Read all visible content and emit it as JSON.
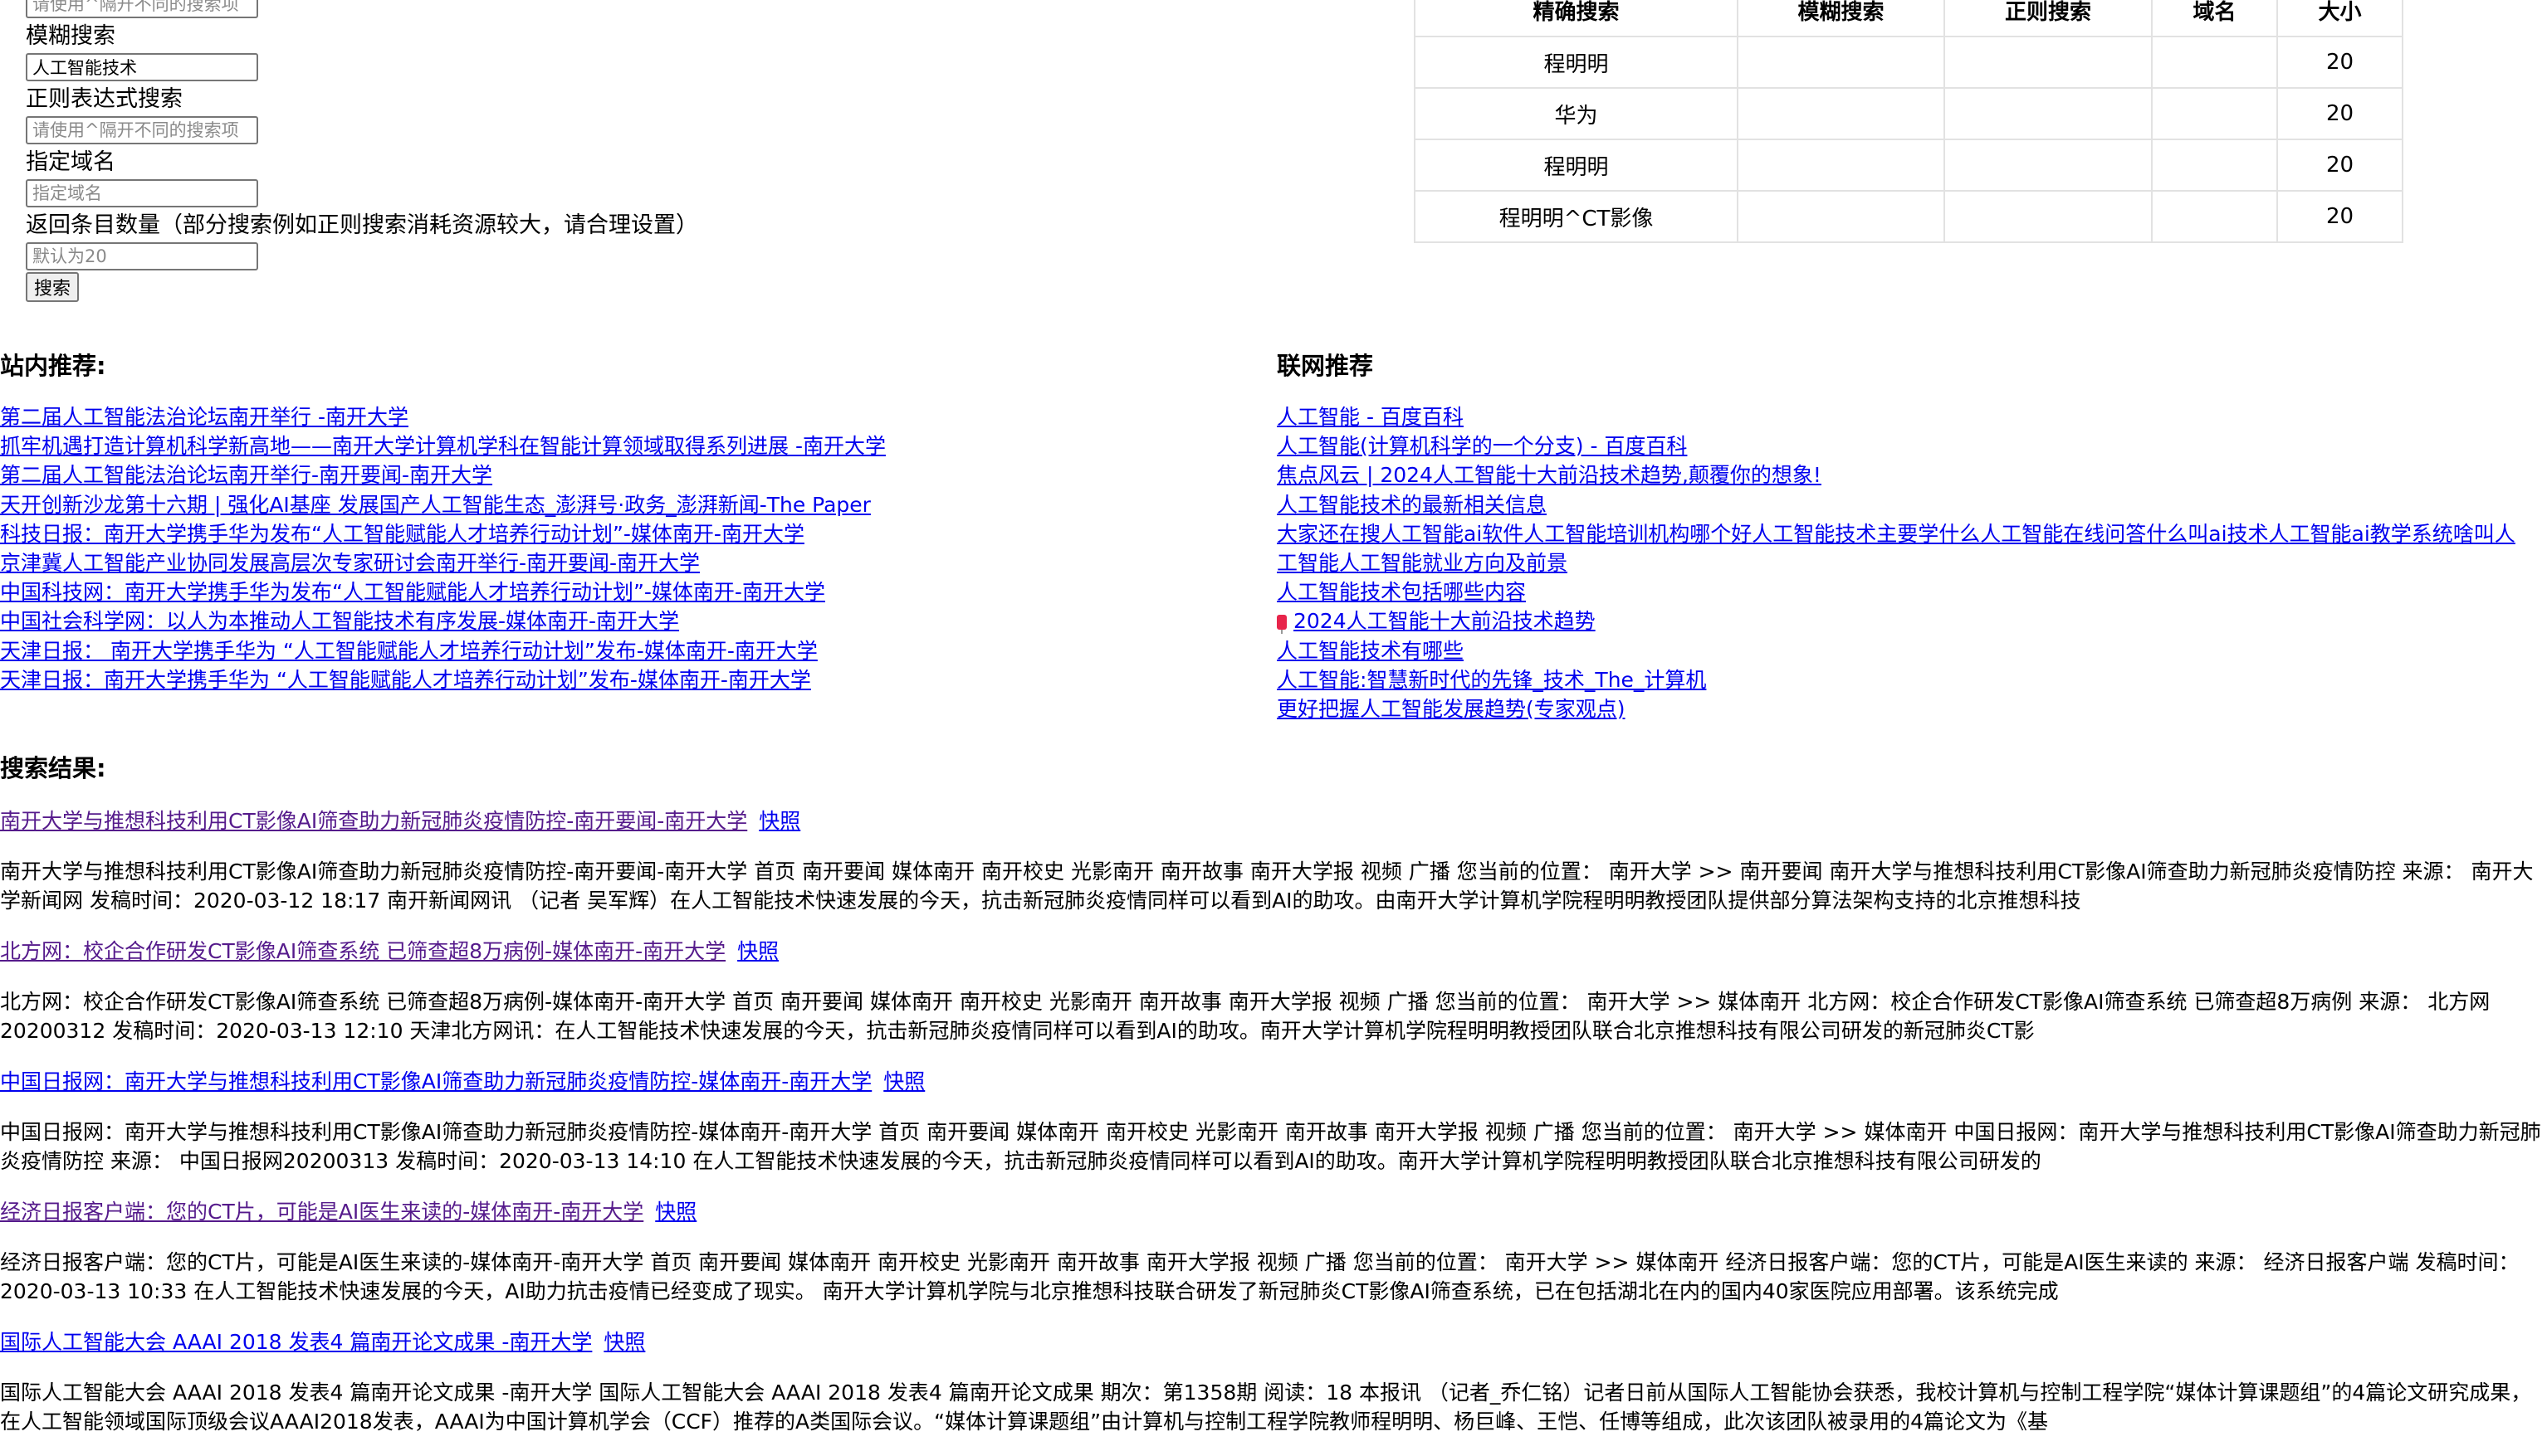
{
  "form": {
    "exact_placeholder": "请使用^隔开不同的搜索项",
    "fuzzy_label": "模糊搜索",
    "fuzzy_value": "人工智能技术",
    "regex_label": "正则表达式搜索",
    "regex_placeholder": "请使用^隔开不同的搜索项",
    "domain_label": "指定域名",
    "domain_placeholder": "指定域名",
    "count_label": "返回条目数量（部分搜索例如正则搜索消耗资源较大，请合理设置）",
    "count_placeholder": "默认为20",
    "search_button": "搜索"
  },
  "history_table": {
    "headers": [
      "精确搜索",
      "模糊搜索",
      "正则搜索",
      "域名",
      "大小"
    ],
    "rows": [
      [
        "程明明",
        "",
        "",
        "",
        "20"
      ],
      [
        "华为",
        "",
        "",
        "",
        "20"
      ],
      [
        "程明明",
        "",
        "",
        "",
        "20"
      ],
      [
        "程明明^CT影像",
        "",
        "",
        "",
        "20"
      ]
    ]
  },
  "site_recommend": {
    "heading": "站内推荐:",
    "links": [
      "第二届人工智能法治论坛南开举行 -南开大学",
      "抓牢机遇打造计算机科学新高地——南开大学计算机学科在智能计算领域取得系列进展 -南开大学",
      "第二届人工智能法治论坛南开举行-南开要闻-南开大学",
      "天开创新沙龙第十六期 | 强化AI基座 发展国产人工智能生态_澎湃号·政务_澎湃新闻-The Paper",
      "科技日报：南开大学携手华为发布“人工智能赋能人才培养行动计划”-媒体南开-南开大学",
      "京津冀人工智能产业协同发展高层次专家研讨会南开举行-南开要闻-南开大学",
      "中国科技网：南开大学携手华为发布“人工智能赋能人才培养行动计划”-媒体南开-南开大学",
      "中国社会科学网：以人为本推动人工智能技术有序发展-媒体南开-南开大学",
      "天津日报： 南开大学携手华为 “人工智能赋能人才培养行动计划”发布-媒体南开-南开大学",
      "天津日报：南开大学携手华为 “人工智能赋能人才培养行动计划”发布-媒体南开-南开大学"
    ]
  },
  "web_recommend": {
    "heading": "联网推荐",
    "links": [
      "人工智能 - 百度百科",
      "人工智能(计算机科学的一个分支) - 百度百科",
      "焦点风云 | 2024人工智能十大前沿技术趋势,颠覆你的想象!",
      "人工智能技术的最新相关信息",
      "大家还在搜人工智能ai软件人工智能培训机构哪个好人工智能技术主要学什么人工智能在线问答什么叫ai技术人工智能ai教学系统啥叫人",
      "工智能人工智能就业方向及前景",
      "人工智能技术包括哪些内容",
      "2024人工智能十大前沿技术趋势",
      "人工智能技术有哪些",
      "人工智能:智慧新时代的先锋_技术_The_计算机",
      "更好把握人工智能发展趋势(专家观点)"
    ]
  },
  "results": {
    "heading": "搜索结果:",
    "snapshot_label": "快照",
    "items": [
      {
        "title": "南开大学与推想科技利用CT影像AI筛查助力新冠肺炎疫情防控-南开要闻-南开大学",
        "snippet": "南开大学与推想科技利用CT影像AI筛查助力新冠肺炎疫情防控-南开要闻-南开大学 首页 南开要闻 媒体南开 南开校史 光影南开 南开故事 南开大学报 视频 广播 您当前的位置： 南开大学 >> 南开要闻 南开大学与推想科技利用CT影像AI筛查助力新冠肺炎疫情防控 来源： 南开大学新闻网 发稿时间：2020-03-12 18:17 南开新闻网讯 （记者 吴军辉）在人工智能技术快速发展的今天，抗击新冠肺炎疫情同样可以看到AI的助攻。由南开大学计算机学院程明明教授团队提供部分算法架构支持的北京推想科技"
      },
      {
        "title": "北方网：校企合作研发CT影像AI筛查系统 已筛查超8万病例-媒体南开-南开大学",
        "snippet": "北方网：校企合作研发CT影像AI筛查系统 已筛查超8万病例-媒体南开-南开大学 首页 南开要闻 媒体南开 南开校史 光影南开 南开故事 南开大学报 视频 广播 您当前的位置： 南开大学 >> 媒体南开 北方网：校企合作研发CT影像AI筛查系统 已筛查超8万病例 来源： 北方网20200312 发稿时间：2020-03-13 12:10 天津北方网讯：在人工智能技术快速发展的今天，抗击新冠肺炎疫情同样可以看到AI的助攻。南开大学计算机学院程明明教授团队联合北京推想科技有限公司研发的新冠肺炎CT影"
      },
      {
        "title": "中国日报网：南开大学与推想科技利用CT影像AI筛查助力新冠肺炎疫情防控-媒体南开-南开大学",
        "snippet": "中国日报网：南开大学与推想科技利用CT影像AI筛查助力新冠肺炎疫情防控-媒体南开-南开大学 首页 南开要闻 媒体南开 南开校史 光影南开 南开故事 南开大学报 视频 广播 您当前的位置： 南开大学 >> 媒体南开 中国日报网：南开大学与推想科技利用CT影像AI筛查助力新冠肺炎疫情防控 来源： 中国日报网20200313 发稿时间：2020-03-13 14:10 在人工智能技术快速发展的今天，抗击新冠肺炎疫情同样可以看到AI的助攻。南开大学计算机学院程明明教授团队联合北京推想科技有限公司研发的"
      },
      {
        "title": "经济日报客户端：您的CT片，可能是AI医生来读的-媒体南开-南开大学",
        "snippet": "经济日报客户端：您的CT片，可能是AI医生来读的-媒体南开-南开大学 首页 南开要闻 媒体南开 南开校史 光影南开 南开故事 南开大学报 视频 广播 您当前的位置： 南开大学 >> 媒体南开 经济日报客户端：您的CT片，可能是AI医生来读的 来源： 经济日报客户端 发稿时间：2020-03-13 10:33 在人工智能技术快速发展的今天，AI助力抗击疫情已经变成了现实。 南开大学计算机学院与北京推想科技联合研发了新冠肺炎CT影像AI筛查系统，已在包括湖北在内的国内40家医院应用部署。该系统完成"
      },
      {
        "title": "国际人工智能大会 AAAI 2018 发表4 篇南开论文成果 -南开大学",
        "snippet": "国际人工智能大会 AAAI 2018 发表4 篇南开论文成果 -南开大学 国际人工智能大会 AAAI 2018 发表4 篇南开论文成果 期次：第1358期 阅读：18 本报讯 （记者_乔仁铭）记者日前从国际人工智能协会获悉，我校计算机与控制工程学院“媒体计算课题组”的4篇论文研究成果，在人工智能领域国际顶级会议AAAI2018发表，AAAI为中国计算机学会（CCF）推荐的A类国际会议。“媒体计算课题组”由计算机与控制工程学院教师程明明、杨巨峰、王恺、任博等组成，此次该团队被录用的4篇论文为《基"
      }
    ]
  },
  "colors": {
    "link": "#0000EE",
    "visited": "#551A8B"
  }
}
